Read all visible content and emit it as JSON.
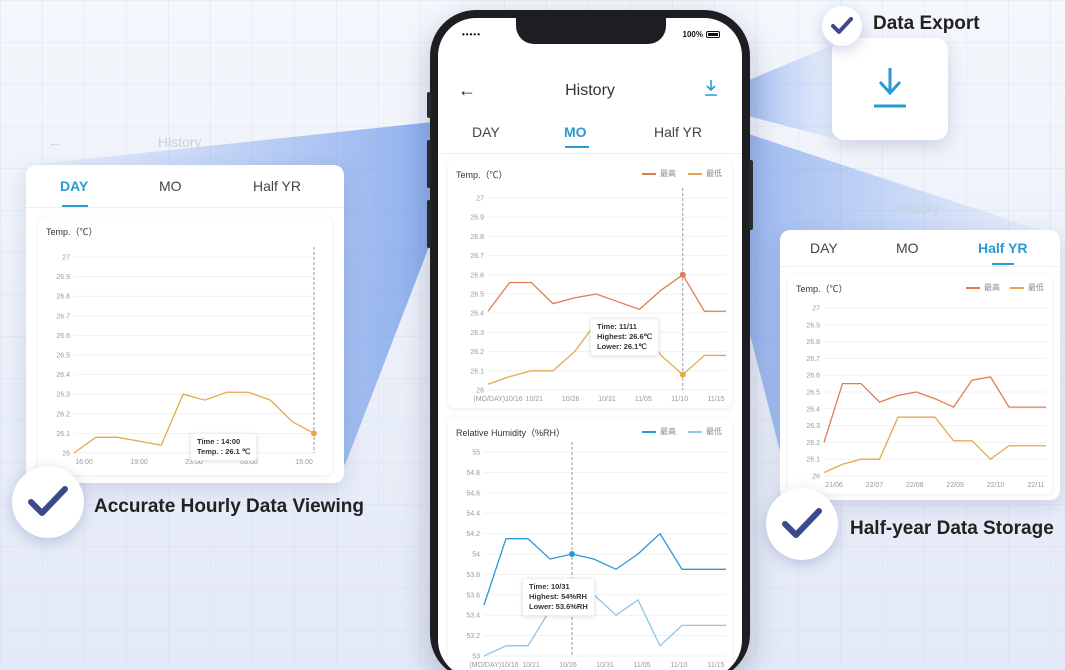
{
  "colors": {
    "accent": "#2a9ad6",
    "max_temp": "#e07b52",
    "min_temp": "#e8a84a",
    "max_hum": "#2a9ad6",
    "min_hum": "#8fc6ea",
    "check": "#3c4a8c"
  },
  "icons": {
    "back": "arrow-left-icon",
    "download": "download-icon",
    "check": "check-icon"
  },
  "status": {
    "signal": "•••••",
    "battery": "100%"
  },
  "header": {
    "back": "←",
    "title": "History"
  },
  "tabs": [
    {
      "label": "DAY"
    },
    {
      "label": "MO"
    },
    {
      "label": "Half YR"
    }
  ],
  "active_tab": "MO",
  "features": {
    "export": "Data Export",
    "hourly": "Accurate Hourly Data Viewing",
    "storage": "Half-year Data Storage"
  },
  "ghost": {
    "history": "History",
    "back": "←"
  },
  "legend": {
    "max": "最高",
    "min": "最低"
  },
  "temp_card": {
    "title": "Temp.（℃）",
    "tooltip": {
      "time": "Time: 11/11",
      "highest": "Highest: 26.6℃",
      "lower": "Lower: 26.1℃"
    }
  },
  "humidity_card": {
    "title": "Relative Humidity（%RH）",
    "tooltip": {
      "time": "Time: 10/31",
      "highest": "Highest: 54%RH",
      "lower": "Lower: 53.6%RH"
    }
  },
  "left_panel": {
    "title": "Temp.（℃）",
    "active_tab": "DAY",
    "tooltip": {
      "time": "Time : 14:00",
      "temp": "Temp. : 26.1 ℃"
    }
  },
  "right_panel": {
    "title": "Temp.（℃）",
    "active_tab": "Half YR"
  },
  "chart_data": [
    {
      "id": "month-temp",
      "type": "line",
      "title": "Temp.（℃）",
      "y_ticks": [
        "27",
        "26.9",
        "26.8",
        "26.7",
        "26.6",
        "26.5",
        "26.4",
        "26.3",
        "26.2",
        "26.1",
        "26"
      ],
      "ylim": [
        26,
        27
      ],
      "x_tick_labels": [
        "(MO/DAY)10/16",
        "10/21",
        "10/26",
        "10/31",
        "11/05",
        "11/10",
        "11/15"
      ],
      "x": [
        0,
        1,
        2,
        3,
        4,
        5,
        6,
        7,
        8,
        9,
        10,
        11
      ],
      "series": [
        {
          "name": "最高",
          "color": "#e07b52",
          "values": [
            26.41,
            26.56,
            26.56,
            26.45,
            26.48,
            26.5,
            26.46,
            26.42,
            26.52,
            26.6,
            26.41,
            26.41
          ]
        },
        {
          "name": "最低",
          "color": "#e8a84a",
          "values": [
            26.03,
            26.07,
            26.1,
            26.1,
            26.2,
            26.35,
            26.35,
            26.35,
            26.18,
            26.08,
            26.18,
            26.18
          ]
        }
      ],
      "highlight_index": 9
    },
    {
      "id": "month-humidity",
      "type": "line",
      "title": "Relative Humidity（%RH）",
      "y_ticks": [
        "55",
        "54.8",
        "54.6",
        "54.4",
        "54.2",
        "54",
        "53.8",
        "53.6",
        "53.4",
        "53.2",
        "53"
      ],
      "ylim": [
        53,
        55
      ],
      "x_tick_labels": [
        "(MO/DAY)10/16",
        "10/21",
        "10/26",
        "10/31",
        "11/05",
        "11/10",
        "11/15"
      ],
      "x": [
        0,
        1,
        2,
        3,
        4,
        5,
        6,
        7,
        8,
        9,
        10,
        11
      ],
      "series": [
        {
          "name": "最高",
          "color": "#2a9ad6",
          "values": [
            53.5,
            54.15,
            54.15,
            53.95,
            54.0,
            53.95,
            53.85,
            54.0,
            54.2,
            53.85,
            53.85,
            53.85
          ]
        },
        {
          "name": "最低",
          "color": "#8fc6ea",
          "values": [
            53.0,
            53.1,
            53.1,
            53.45,
            53.6,
            53.6,
            53.4,
            53.55,
            53.1,
            53.3,
            53.3,
            53.3
          ]
        }
      ],
      "highlight_index": 4
    },
    {
      "id": "day-temp",
      "type": "line",
      "title": "Temp.（℃）",
      "y_ticks": [
        "27",
        "26.9",
        "26.8",
        "26.7",
        "26.6",
        "26.5",
        "26.4",
        "26.3",
        "26.2",
        "26.1",
        "26"
      ],
      "ylim": [
        26,
        27
      ],
      "x_tick_labels": [
        "16:00",
        "19:00",
        "23:00",
        "03:00",
        "15:00"
      ],
      "x": [
        0,
        1,
        2,
        3,
        4,
        5,
        6,
        7,
        8,
        9,
        10,
        11
      ],
      "series": [
        {
          "name": "Temp.",
          "color": "#e8a84a",
          "values": [
            26.0,
            26.08,
            26.08,
            26.06,
            26.04,
            26.3,
            26.27,
            26.31,
            26.31,
            26.27,
            26.16,
            26.1
          ]
        }
      ],
      "highlight_index": 11
    },
    {
      "id": "halfyear-temp",
      "type": "line",
      "title": "Temp.（℃）",
      "y_ticks": [
        "27",
        "26.9",
        "26.8",
        "26.7",
        "26.6",
        "26.5",
        "26.4",
        "26.3",
        "26.2",
        "26.1",
        "26"
      ],
      "ylim": [
        26,
        27
      ],
      "x_tick_labels": [
        "21/06",
        "22/07",
        "22/08",
        "22/09",
        "22/10",
        "22/11"
      ],
      "x": [
        0,
        1,
        2,
        3,
        4,
        5,
        6,
        7,
        8,
        9,
        10,
        11,
        12
      ],
      "series": [
        {
          "name": "最高",
          "color": "#e07b52",
          "values": [
            26.2,
            26.55,
            26.55,
            26.44,
            26.48,
            26.5,
            26.46,
            26.41,
            26.57,
            26.59,
            26.41,
            26.41,
            26.41
          ]
        },
        {
          "name": "最低",
          "color": "#e8a84a",
          "values": [
            26.02,
            26.07,
            26.1,
            26.1,
            26.35,
            26.35,
            26.35,
            26.21,
            26.21,
            26.1,
            26.18,
            26.18,
            26.18
          ]
        }
      ],
      "highlight_index": -1
    }
  ]
}
